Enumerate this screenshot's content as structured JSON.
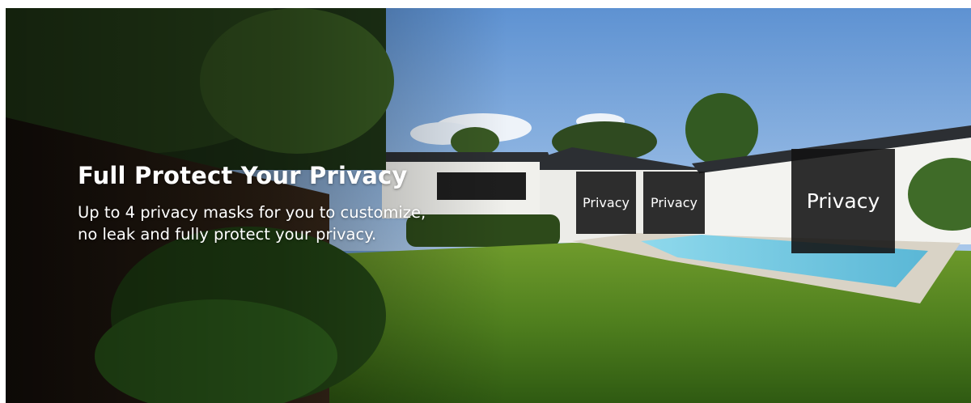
{
  "banner": {
    "headline": "Full Protect Your Privacy",
    "subline_line1": "Up to 4 privacy masks for you to customize,",
    "subline_line2": "no leak and fully protect your privacy."
  },
  "privacy_masks": [
    {
      "label": "Privacy"
    },
    {
      "label": "Privacy"
    },
    {
      "label": "Privacy"
    }
  ],
  "colors": {
    "sky": "#6f9fd6",
    "lawn": "#5a8a24",
    "pool": "#7fd0e6",
    "house": "#f2f2ef",
    "mask": "#121212",
    "text": "#ffffff"
  }
}
